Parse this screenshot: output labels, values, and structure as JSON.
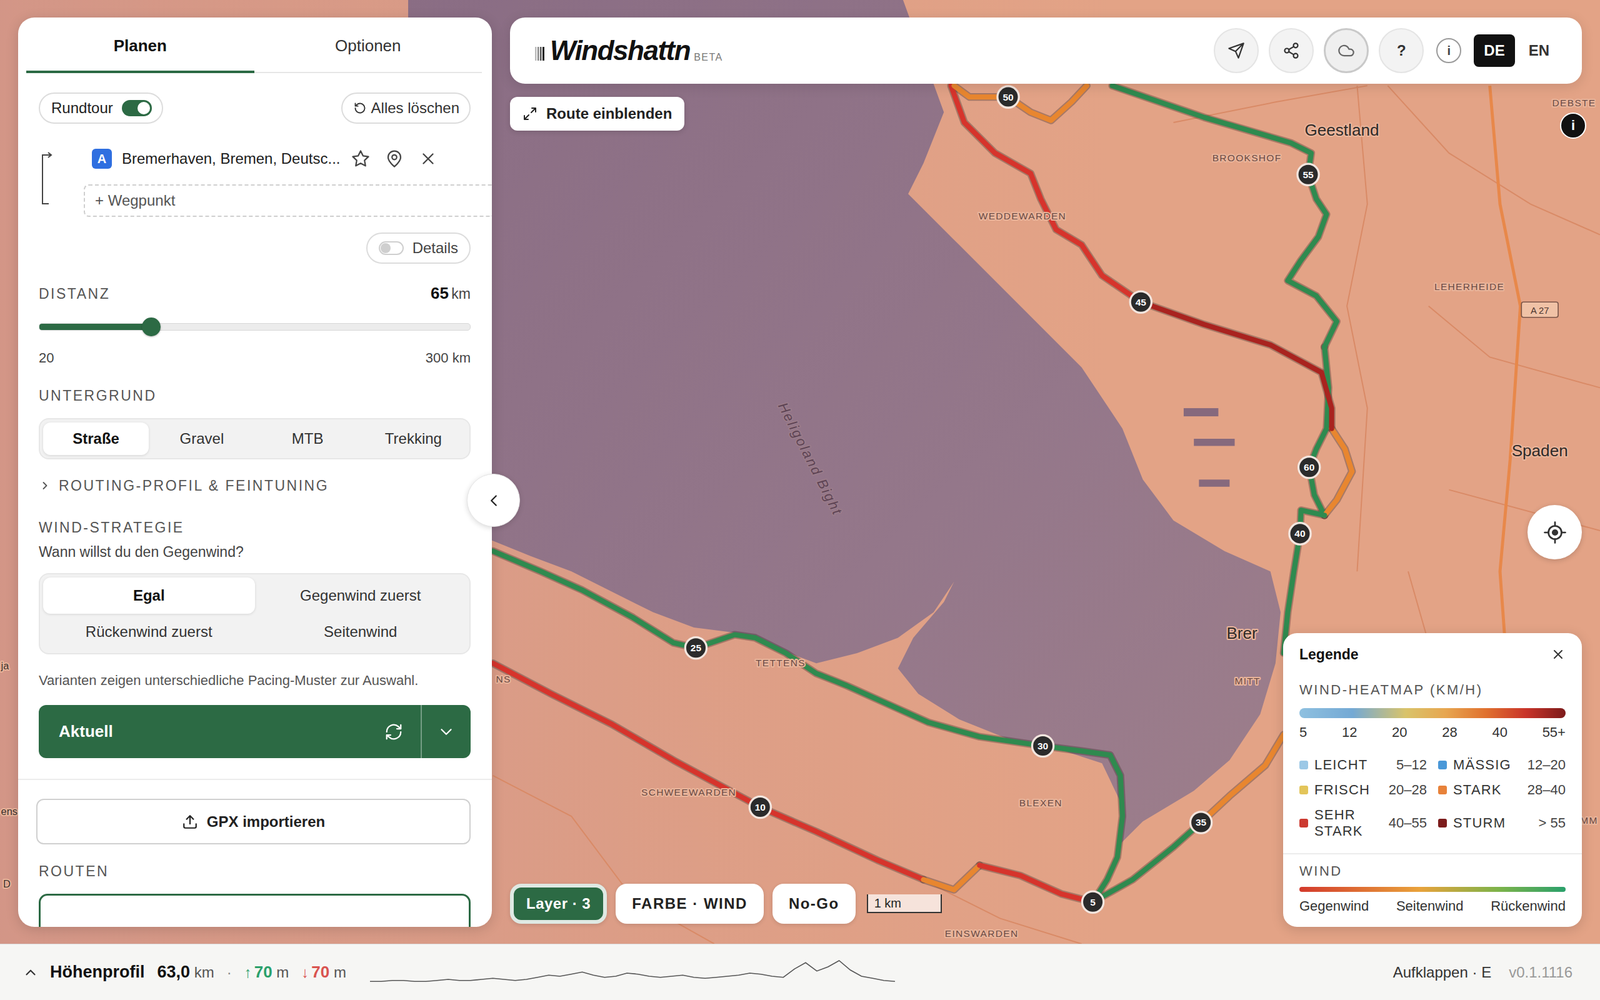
{
  "header": {
    "logo": "Windshattn",
    "badge": "BETA",
    "tools": [
      {
        "kind": "send",
        "active": false
      },
      {
        "kind": "share",
        "active": false
      },
      {
        "kind": "cloud",
        "active": true
      },
      {
        "kind": "help",
        "label": "?",
        "active": false
      },
      {
        "kind": "info",
        "label": "i",
        "active": false
      }
    ],
    "languages": [
      {
        "label": "DE",
        "selected": true
      },
      {
        "label": "EN",
        "selected": false
      }
    ]
  },
  "panel": {
    "tabs": [
      {
        "label": "Planen",
        "selected": true
      },
      {
        "label": "Optionen",
        "selected": false
      }
    ],
    "roundtrip": {
      "label": "Rundtour",
      "on": true
    },
    "clear": "Alles löschen",
    "waypoints": [
      {
        "badge": "A",
        "name": "Bremerhaven, Bremen, Deutsc..."
      }
    ],
    "add_waypoint": "+ Wegpunkt",
    "details": {
      "label": "Details",
      "on": false
    },
    "distance": {
      "label": "DISTANZ",
      "value": "65",
      "unit": "km",
      "level": 0.26,
      "min": "20",
      "max": "300 km"
    },
    "surface": {
      "label": "UNTERGRUND",
      "options": [
        {
          "label": "Straße",
          "selected": true
        },
        {
          "label": "Gravel",
          "selected": false
        },
        {
          "label": "MTB",
          "selected": false
        },
        {
          "label": "Trekking",
          "selected": false
        }
      ]
    },
    "routing_profile": {
      "label": "ROUTING-PROFIL & FEINTUNING",
      "expanded": false
    },
    "wind_strategy": {
      "label": "WIND-STRATEGIE",
      "question": "Wann willst du den Gegenwind?",
      "options": [
        {
          "label": "Egal",
          "selected": true
        },
        {
          "label": "Gegenwind zuerst",
          "selected": false
        },
        {
          "label": "Rückenwind zuerst",
          "selected": false
        },
        {
          "label": "Seitenwind",
          "selected": false
        }
      ],
      "note": "Varianten zeigen unterschiedliche Pacing-Muster zur Auswahl."
    },
    "action": "Aktuell",
    "gpx": "GPX importieren",
    "routes_label": "ROUTEN"
  },
  "map": {
    "route_button": "Route einblenden",
    "info": "i",
    "labels": [
      {
        "text": "DEBSTE",
        "kind": "district"
      },
      {
        "text": "Geestland",
        "kind": "city"
      },
      {
        "text": "BROOKSHOF",
        "kind": "district"
      },
      {
        "text": "WEDDEWARDEN",
        "kind": "district"
      },
      {
        "text": "LEHERHEIDE",
        "kind": "district"
      },
      {
        "text": "A 27",
        "kind": "road"
      },
      {
        "text": "Heligoland Bight",
        "kind": "water"
      },
      {
        "text": "Spaden",
        "kind": "city"
      },
      {
        "text": "Brer",
        "kind": "city"
      },
      {
        "text": "MITT",
        "kind": "district"
      },
      {
        "text": "TETTENS",
        "kind": "district"
      },
      {
        "text": "SCHWEEWARDEN",
        "kind": "district"
      },
      {
        "text": "BLEXEN",
        "kind": "district"
      },
      {
        "text": "EINSWARDEN",
        "kind": "district"
      },
      {
        "text": "NS",
        "kind": "district"
      },
      {
        "text": "ja",
        "kind": "fragment"
      },
      {
        "text": "ens",
        "kind": "fragment"
      },
      {
        "text": "D",
        "kind": "fragment"
      },
      {
        "text": "MM",
        "kind": "district"
      }
    ],
    "markers": [
      {
        "label": "50"
      },
      {
        "label": "55"
      },
      {
        "label": "45"
      },
      {
        "label": "60"
      },
      {
        "label": "40"
      },
      {
        "label": "25"
      },
      {
        "label": "30"
      },
      {
        "label": "10"
      },
      {
        "label": "35"
      },
      {
        "label": "5"
      }
    ],
    "controls": [
      {
        "label": "Layer · 3",
        "selected": true
      },
      {
        "label": "FARBE · WIND",
        "selected": false
      },
      {
        "label": "No-Go",
        "selected": false
      }
    ],
    "scale": "1 km"
  },
  "legend": {
    "title": "Legende",
    "heatmap_label": "WIND-HEATMAP (KM/H)",
    "ticks": [
      "5",
      "12",
      "20",
      "28",
      "40",
      "55+"
    ],
    "items": [
      {
        "label": "LEICHT",
        "range": "5–12",
        "color": "#9cc8e6"
      },
      {
        "label": "MÄSSIG",
        "range": "12–20",
        "color": "#4a98d8"
      },
      {
        "label": "FRISCH",
        "range": "20–28",
        "color": "#e3c55a"
      },
      {
        "label": "STARK",
        "range": "28–40",
        "color": "#e8823a"
      },
      {
        "label": "SEHR STARK",
        "range": "40–55",
        "color": "#cc3a30"
      },
      {
        "label": "STURM",
        "range": "> 55",
        "color": "#7c1c1c"
      }
    ],
    "wind_label": "WIND",
    "wind_scale": [
      "Gegenwind",
      "Seitenwind",
      "Rückenwind"
    ]
  },
  "elevation": {
    "label": "Höhenprofil",
    "distance": "63,0",
    "distance_unit": "km",
    "separator": "·",
    "ascent": {
      "arrow": "↑",
      "value": "70",
      "unit": "m"
    },
    "descent": {
      "arrow": "↓",
      "value": "70",
      "unit": "m"
    },
    "expanded": false,
    "profile": [
      4,
      4,
      5,
      5,
      4,
      4,
      5,
      6,
      5,
      5,
      6,
      7,
      6,
      5,
      6,
      8,
      10,
      9,
      11,
      13,
      10,
      8,
      9,
      12,
      11,
      9,
      8,
      9,
      10,
      8,
      7,
      8,
      9,
      10,
      12,
      11,
      9,
      8,
      16,
      22,
      14,
      18,
      24,
      15,
      9,
      7,
      5,
      4
    ],
    "expand": "Aufklappen · E",
    "version": "v0.1.1116"
  }
}
